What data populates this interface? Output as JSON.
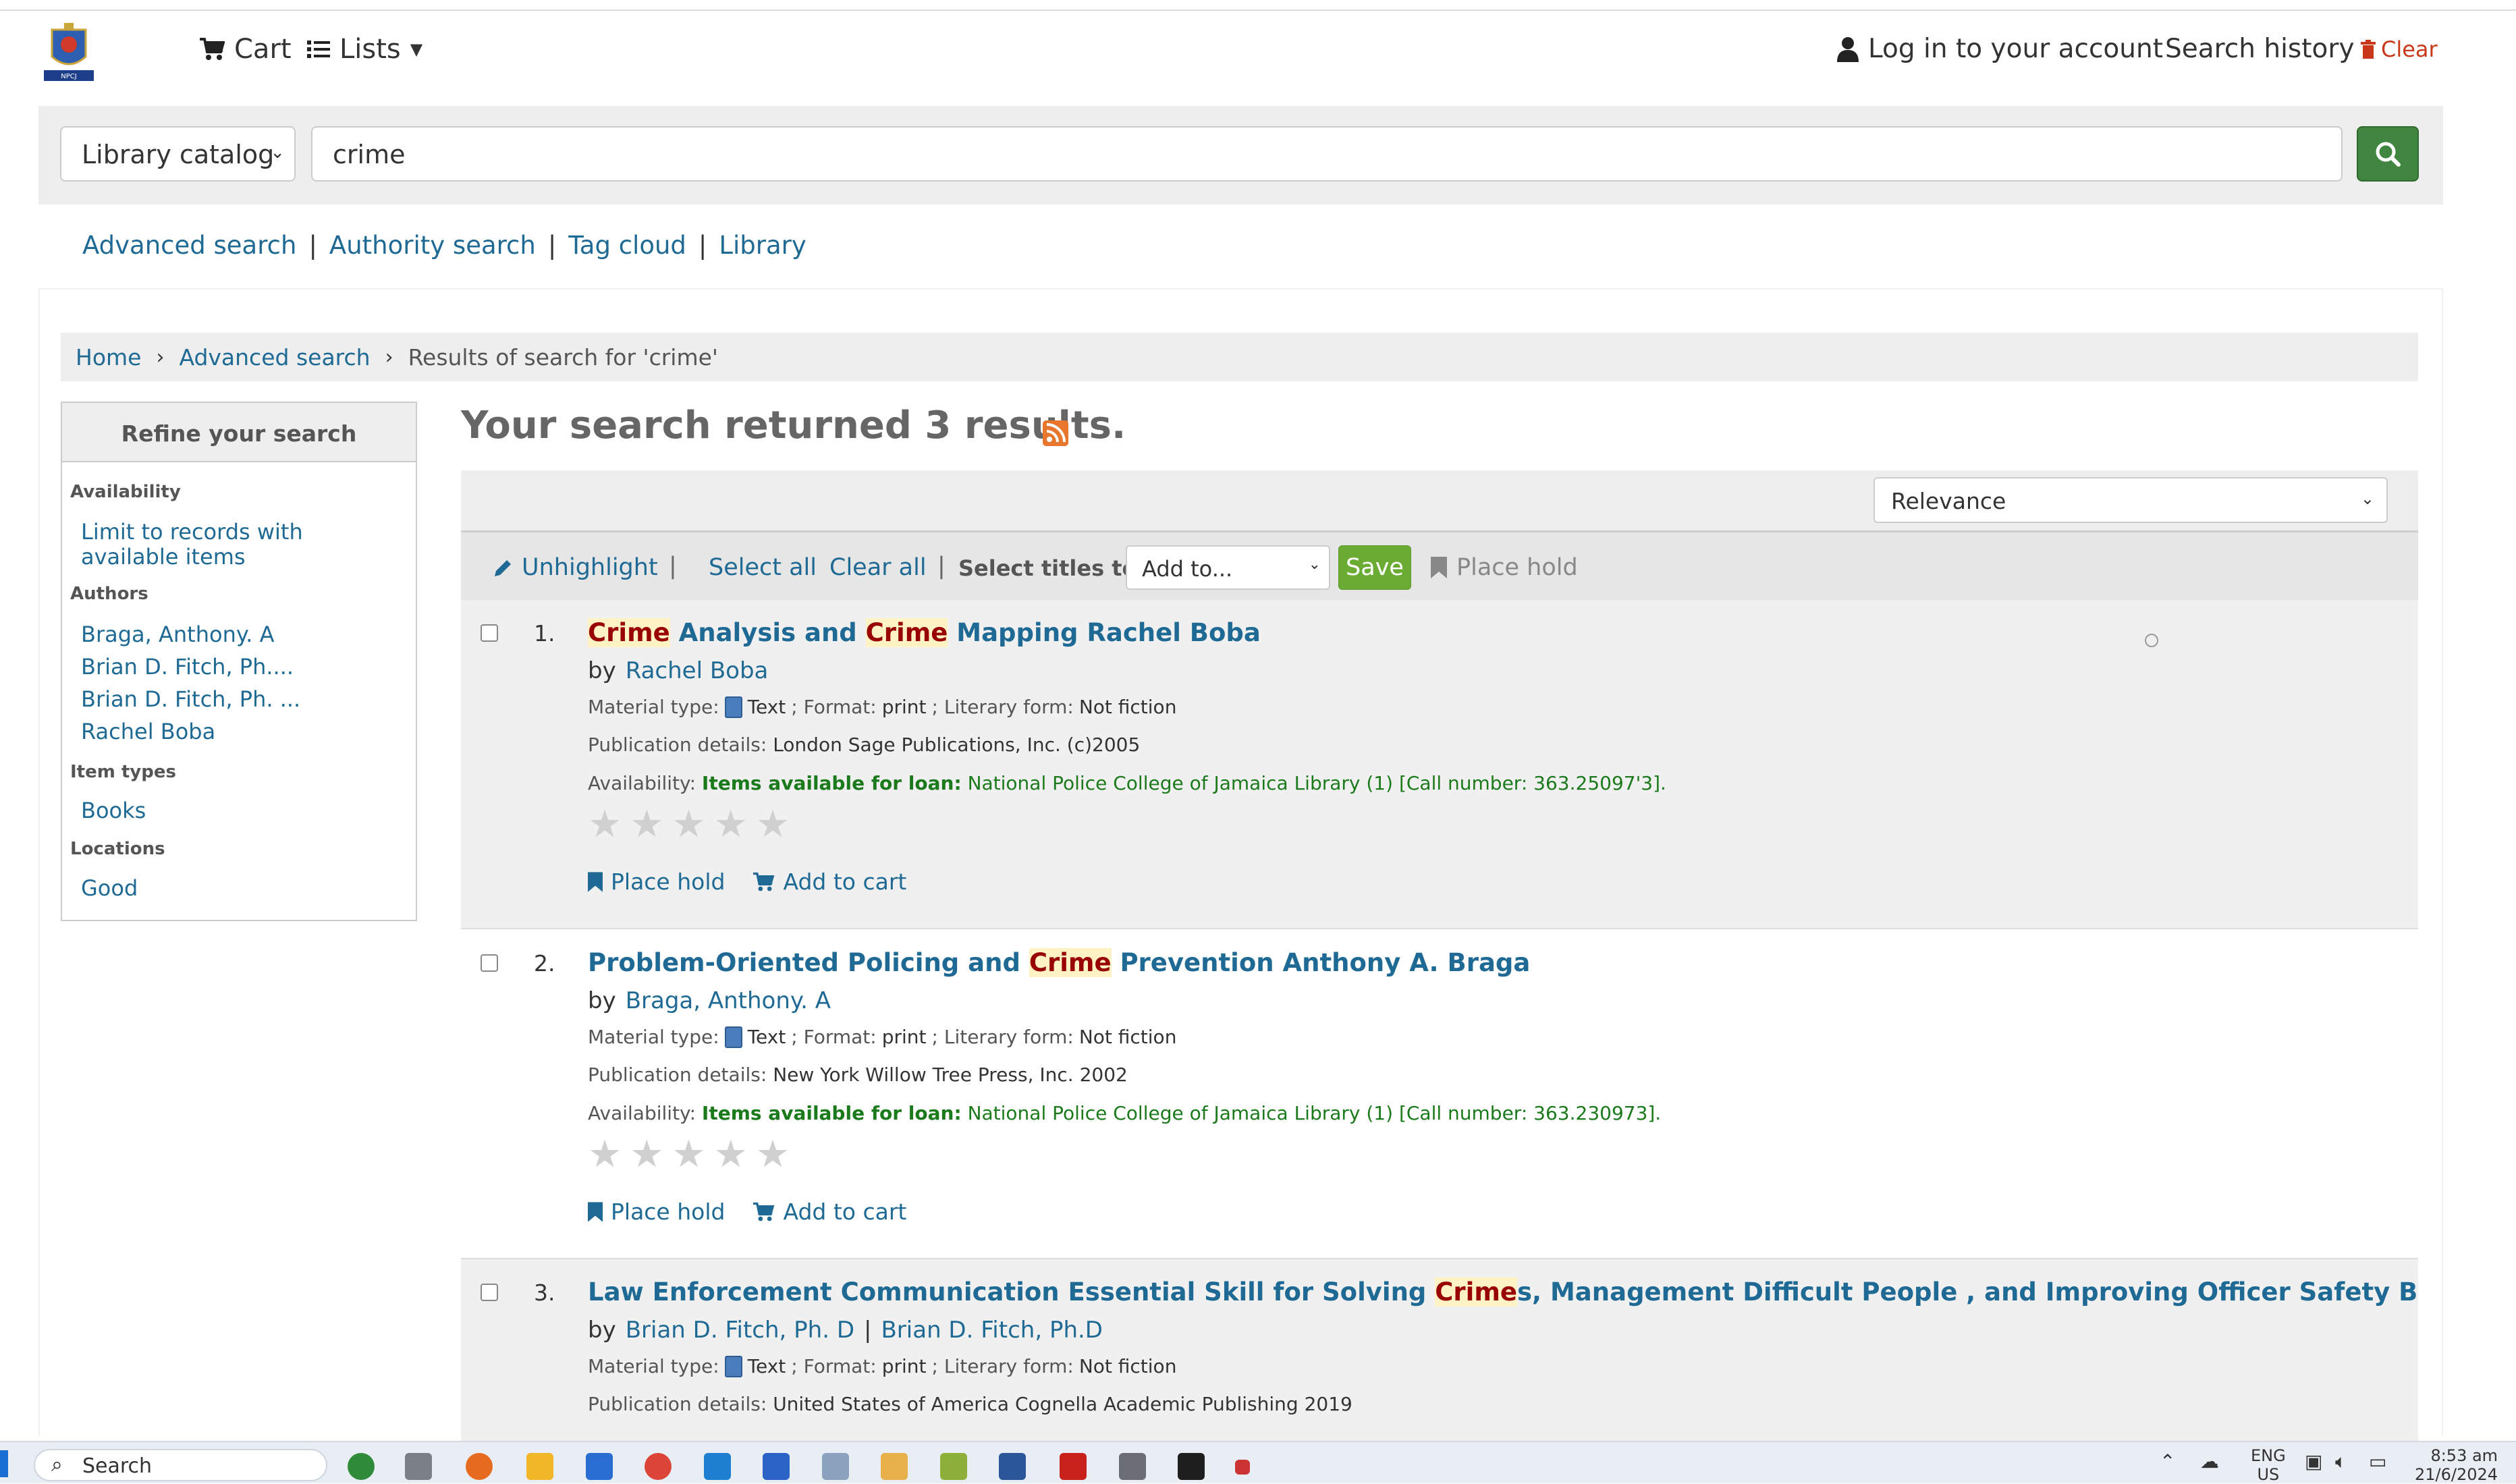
{
  "header": {
    "cart_label": "Cart",
    "lists_label": "Lists",
    "login_label": "Log in to your account",
    "history_label": "Search history",
    "clear_label": "Clear"
  },
  "search": {
    "scope": "Library catalog",
    "query": "crime"
  },
  "moresearches": [
    "Advanced search",
    "Authority search",
    "Tag cloud",
    "Library"
  ],
  "breadcrumb": {
    "home": "Home",
    "advanced": "Advanced search",
    "current": "Results of search for 'crime'"
  },
  "facets": {
    "title": "Refine your search",
    "availability_h": "Availability",
    "availability_link": "Limit to records with available items",
    "authors_h": "Authors",
    "authors": [
      "Braga, Anthony. A",
      "Brian D. Fitch, Ph....",
      "Brian D. Fitch, Ph. ...",
      "Rachel Boba"
    ],
    "itemtypes_h": "Item types",
    "itemtypes": [
      "Books"
    ],
    "locations_h": "Locations",
    "locations": [
      "Good"
    ]
  },
  "results": {
    "title": "Your search returned 3 results.",
    "sort": "Relevance",
    "toolbar": {
      "unhighlight": "Unhighlight",
      "select_all": "Select all",
      "clear_all": "Clear all",
      "select_titles": "Select titles to:",
      "add_to": "Add to...",
      "save": "Save",
      "place_hold": "Place hold"
    },
    "labels": {
      "by": "by",
      "material": "Material type:",
      "text": "Text",
      "format": "; Format:",
      "print": "print",
      "literary": "; Literary form:",
      "notfiction": "Not fiction",
      "pub": "Publication details:",
      "avail": "Availability:",
      "loan": "Items available for loan:",
      "place_hold": "Place hold",
      "add_to_cart": "Add to cart"
    },
    "items": [
      {
        "num": "1.",
        "title_parts": [
          "Crime",
          " Analysis and ",
          "Crime",
          " Mapping Rachel Boba"
        ],
        "authors": [
          "Rachel Boba"
        ],
        "pub": "London Sage Publications, Inc. (c)2005",
        "location": "National Police College of Jamaica Library (1) [Call number: 363.25097'3]."
      },
      {
        "num": "2.",
        "title_parts": [
          "",
          "Problem-Oriented Policing and ",
          "Crime",
          " Prevention Anthony A. Braga"
        ],
        "authors": [
          "Braga, Anthony. A"
        ],
        "pub": "New York Willow Tree Press, Inc. 2002",
        "location": "National Police College of Jamaica Library (1) [Call number: 363.230973]."
      },
      {
        "num": "3.",
        "title_parts": [
          "",
          "Law Enforcement Communication Essential Skill for Solving ",
          "Crime",
          "s, Management Difficult People , and Improving Officer Safety Brian D. Fitch, Ph. D"
        ],
        "authors": [
          "Brian D. Fitch, Ph. D",
          "Brian D. Fitch, Ph.D"
        ],
        "pub": "United States of America Cognella Academic Publishing 2019"
      }
    ]
  },
  "taskbar": {
    "search_label": "Search",
    "lang_top": "ENG",
    "lang_bottom": "US",
    "time": "8:53 am",
    "date": "21/6/2024"
  },
  "colors": {
    "link": "#1f6a94",
    "search_button": "#408540",
    "save_button": "#6aab34",
    "highlight": "#fff3c4",
    "available": "#1b7a1b"
  }
}
